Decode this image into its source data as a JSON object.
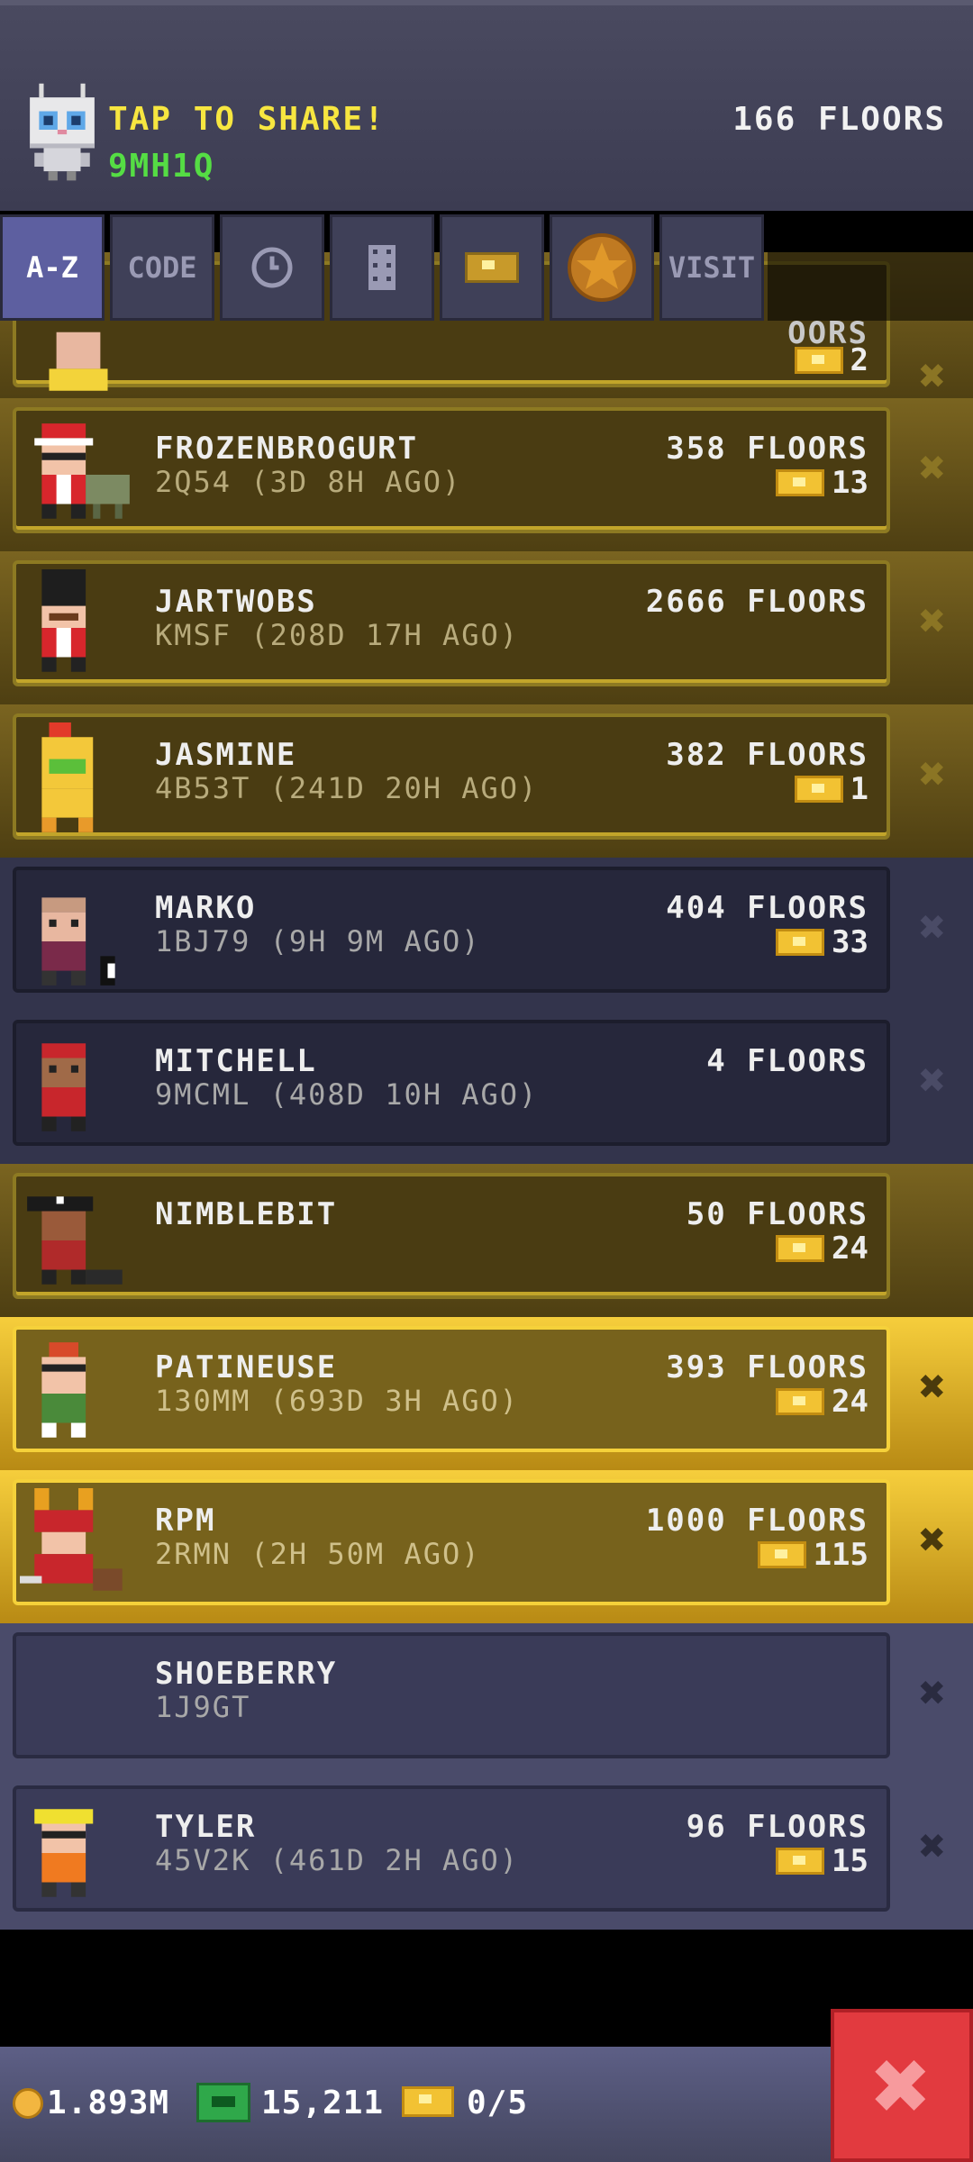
{
  "header": {
    "share_text": "TAP TO SHARE!",
    "player_code": "9MH1Q",
    "total_floors": "166 FLOORS"
  },
  "tabs": [
    {
      "label": "A-Z",
      "icon": "",
      "active": true
    },
    {
      "label": "CODE",
      "icon": "",
      "active": false
    },
    {
      "label": "",
      "icon": "clock-icon",
      "active": false
    },
    {
      "label": "",
      "icon": "tower-icon",
      "active": false
    },
    {
      "label": "",
      "icon": "ticket-icon",
      "active": false
    },
    {
      "label": "",
      "icon": "star-icon",
      "active": false
    },
    {
      "label": "VISIT",
      "icon": "",
      "active": false
    }
  ],
  "partial_row": {
    "floors": "OORS",
    "bux": "2"
  },
  "friends": [
    {
      "name": "FROZENBROGURT",
      "sub": "2Q54 (3D 8H AGO)",
      "floors": "358 FLOORS",
      "bux": "13",
      "style": "gold"
    },
    {
      "name": "JARTWOBS",
      "sub": "KMSF (208D 17H AGO)",
      "floors": "2666 FLOORS",
      "bux": "",
      "style": "gold"
    },
    {
      "name": "JASMINE",
      "sub": "4B53T (241D 20H AGO)",
      "floors": "382 FLOORS",
      "bux": "1",
      "style": "gold"
    },
    {
      "name": "MARKO",
      "sub": "1BJ79 (9H 9M AGO)",
      "floors": "404 FLOORS",
      "bux": "33",
      "style": "navy"
    },
    {
      "name": "MITCHELL",
      "sub": "9MCML (408D 10H AGO)",
      "floors": "4 FLOORS",
      "bux": "",
      "style": "navy"
    },
    {
      "name": "NIMBLEBIT",
      "sub": "",
      "floors": "50 FLOORS",
      "bux": "24",
      "style": "gold"
    },
    {
      "name": "PATINEUSE",
      "sub": "130MM (693D 3H AGO)",
      "floors": "393 FLOORS",
      "bux": "24",
      "style": "bright"
    },
    {
      "name": "RPM",
      "sub": "2RMN (2H 50M AGO)",
      "floors": "1000 FLOORS",
      "bux": "115",
      "style": "bright"
    },
    {
      "name": "SHOEBERRY",
      "sub": "1J9GT",
      "floors": "",
      "bux": "",
      "style": "lav"
    },
    {
      "name": "TYLER",
      "sub": "45V2K (461D 2H AGO)",
      "floors": "96 FLOORS",
      "bux": "15",
      "style": "lav"
    }
  ],
  "footer": {
    "coins": "1.893M",
    "cash": "15,211",
    "bux": "0/5"
  },
  "colors": {
    "share_yellow": "#f7e640",
    "code_green": "#55dd44",
    "close_red": "#e23a3f"
  }
}
